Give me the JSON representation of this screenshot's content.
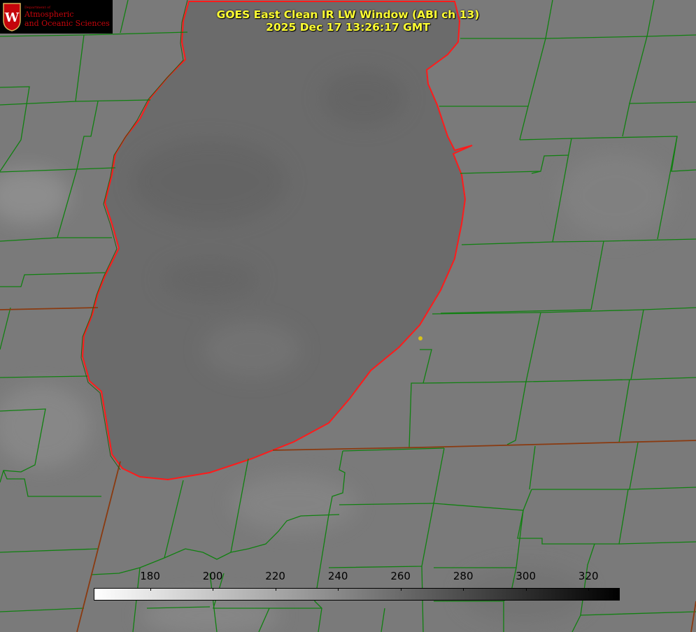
{
  "logo": {
    "department": "Department of",
    "line1": "Atmospheric",
    "line2": "and Oceanic Sciences",
    "crest_letter": "W"
  },
  "title": {
    "line1": "GOES East Clean IR LW Window (ABI ch 13)",
    "line2": "2025 Dec 17 13:26:17 GMT"
  },
  "colorbar": {
    "ticks": [
      "180",
      "200",
      "220",
      "240",
      "260",
      "280",
      "300",
      "320"
    ],
    "range": [
      162,
      330
    ],
    "colormap": "white-to-black"
  },
  "colors": {
    "background": "#7a7a7a",
    "lake": "#6b6b6b",
    "lake_outline": "#ff1a1a",
    "boundaries": "#108010",
    "state_line": "#8a3a10",
    "title_text": "#ffff33",
    "marker": "#d6c21a"
  }
}
